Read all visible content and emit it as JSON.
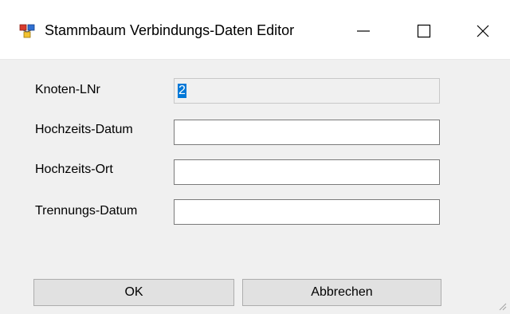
{
  "window": {
    "title": "Stammbaum Verbindungs-Daten Editor",
    "app_icon": "tree-app-icon",
    "controls": {
      "minimize_icon": "minimize-icon",
      "maximize_icon": "maximize-icon",
      "close_icon": "close-icon"
    }
  },
  "form": {
    "fields": [
      {
        "label": "Knoten-LNr",
        "value": "2",
        "readonly": true
      },
      {
        "label": "Hochzeits-Datum",
        "value": ""
      },
      {
        "label": "Hochzeits-Ort",
        "value": ""
      },
      {
        "label": "Trennungs-Datum",
        "value": ""
      }
    ]
  },
  "buttons": {
    "ok_label": "OK",
    "cancel_label": "Abbrechen"
  },
  "colors": {
    "window_bg": "#f0f0f0",
    "selection": "#0078d7",
    "button_bg": "#e1e1e1"
  }
}
